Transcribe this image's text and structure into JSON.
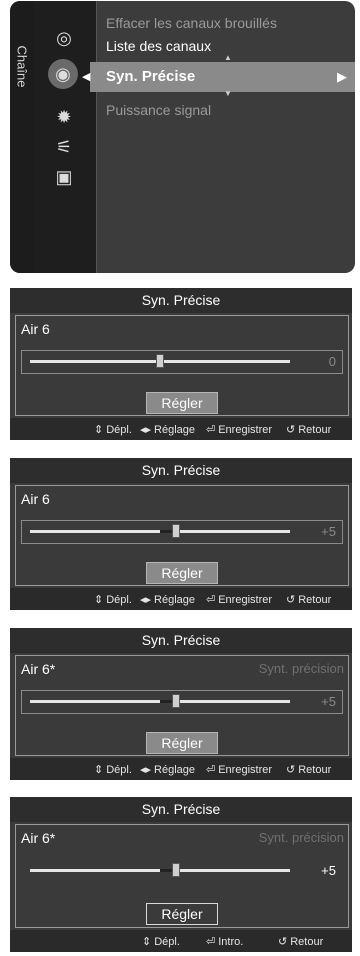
{
  "menu": {
    "section_label": "Chaîne",
    "items": [
      {
        "label": "Effacer les canaux brouillés"
      },
      {
        "label": "Liste des canaux"
      },
      {
        "label": "Syn. Précise"
      },
      {
        "label": "Puissance signal"
      }
    ],
    "icons": [
      "satellite-dish-icon",
      "globe-icon",
      "gear-icon",
      "antenna-icon",
      "picture-icon"
    ]
  },
  "panels": [
    {
      "title": "Syn. Précise",
      "channel": "Air 6",
      "fine_label": "",
      "value": "0",
      "value_num": 0,
      "button": "Régler",
      "footer": {
        "move": "Dépl.",
        "adjust": "Réglage",
        "save": "Enregistrer",
        "back": "Retour"
      }
    },
    {
      "title": "Syn. Précise",
      "channel": "Air 6",
      "fine_label": "",
      "value": "+5",
      "value_num": 5,
      "button": "Régler",
      "footer": {
        "move": "Dépl.",
        "adjust": "Réglage",
        "save": "Enregistrer",
        "back": "Retour"
      }
    },
    {
      "title": "Syn. Précise",
      "channel": "Air 6*",
      "fine_label": "Synt. précision",
      "value": "+5",
      "value_num": 5,
      "button": "Régler",
      "footer": {
        "move": "Dépl.",
        "adjust": "Réglage",
        "save": "Enregistrer",
        "back": "Retour"
      }
    },
    {
      "title": "Syn. Précise",
      "channel": "Air 6*",
      "fine_label": "Synt. précision",
      "value": "+5",
      "value_num": 5,
      "button": "Régler",
      "footer": {
        "move": "Dépl.",
        "enter": "Intro.",
        "back": "Retour"
      }
    }
  ]
}
